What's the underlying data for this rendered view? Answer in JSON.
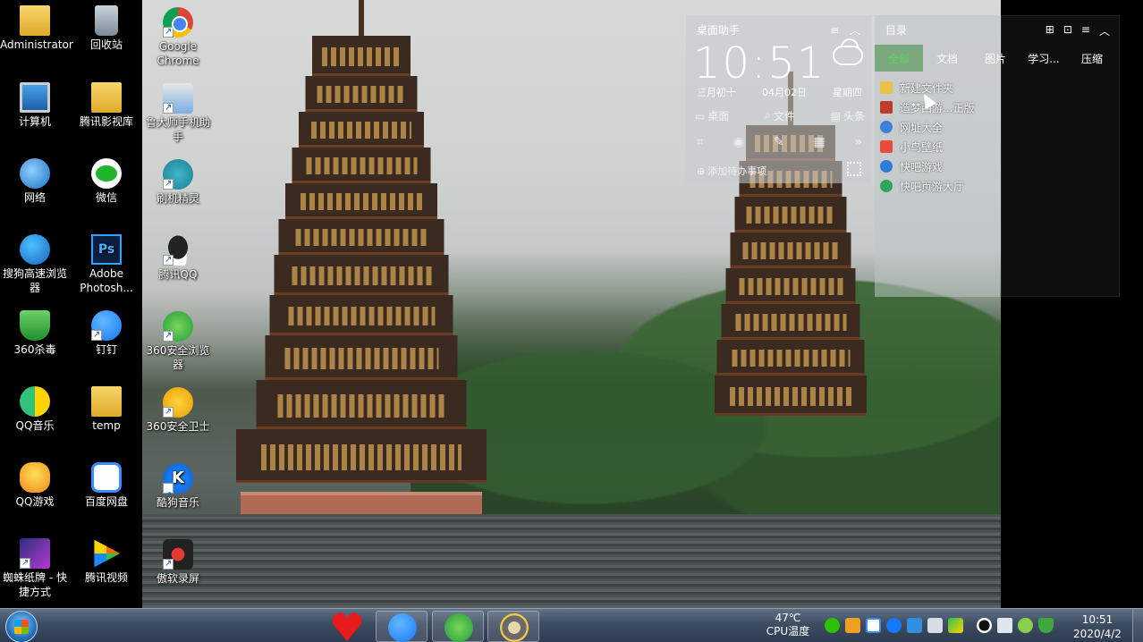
{
  "desktop_icons": [
    {
      "label": "Administrator",
      "icon": "user-folder-icon"
    },
    {
      "label": "回收站",
      "icon": "recycle-bin-icon"
    },
    {
      "label": "计算机",
      "icon": "computer-icon"
    },
    {
      "label": "腾讯影视库",
      "icon": "folder-icon"
    },
    {
      "label": "网络",
      "icon": "network-icon"
    },
    {
      "label": "微信",
      "icon": "wechat-icon"
    },
    {
      "label": "搜狗高速浏览器",
      "icon": "sogou-browser-icon"
    },
    {
      "label": "Adobe Photosh...",
      "icon": "photoshop-icon"
    },
    {
      "label": "360杀毒",
      "icon": "360-antivirus-icon"
    },
    {
      "label": "钉钉",
      "icon": "dingtalk-icon"
    },
    {
      "label": "QQ音乐",
      "icon": "qq-music-icon"
    },
    {
      "label": "temp",
      "icon": "folder-icon"
    },
    {
      "label": "QQ游戏",
      "icon": "qq-game-icon"
    },
    {
      "label": "百度网盘",
      "icon": "baidu-netdisk-icon"
    },
    {
      "label": "蜘蛛纸牌 - 快捷方式",
      "icon": "spider-solitaire-icon"
    },
    {
      "label": "腾讯视频",
      "icon": "tencent-video-icon"
    },
    {
      "label": "Google Chrome",
      "icon": "chrome-icon"
    },
    {
      "label": "鲁大师手机助手",
      "icon": "ludashi-icon"
    },
    {
      "label": "刷机精灵",
      "icon": "shuaji-icon"
    },
    {
      "label": "腾讯QQ",
      "icon": "qq-icon"
    },
    {
      "label": "360安全浏览器",
      "icon": "360-browser-icon"
    },
    {
      "label": "360安全卫士",
      "icon": "360-guard-icon"
    },
    {
      "label": "酷狗音乐",
      "icon": "kugou-icon"
    },
    {
      "label": "傲软录屏",
      "icon": "screen-recorder-icon"
    }
  ],
  "assistant": {
    "title": "桌面助手",
    "time": "10:51",
    "lunar_date": "三月初十",
    "date": "04月02日",
    "weekday": "星期四",
    "shortcuts": [
      "桌面",
      "文件",
      "头条"
    ],
    "todo": "添加待办事项"
  },
  "catalog": {
    "title": "目录",
    "tabs": [
      "全部",
      "文档",
      "图片",
      "学习...",
      "压缩"
    ],
    "items": [
      {
        "label": "新建文件夹",
        "color": "#e8c04a"
      },
      {
        "label": "造梦西游...正版",
        "color": "#c0392b"
      },
      {
        "label": "网址大全",
        "color": "#3b82d6"
      },
      {
        "label": "小鸟壁纸",
        "color": "#e74c3c"
      },
      {
        "label": "快吧游戏",
        "color": "#2f7bd8"
      },
      {
        "label": "快吧页游大厅",
        "color": "#2fa35a"
      }
    ]
  },
  "taskbar": {
    "cpu_temp": "47℃",
    "cpu_label": "CPU温度",
    "time": "10:51",
    "date": "2020/4/2"
  }
}
